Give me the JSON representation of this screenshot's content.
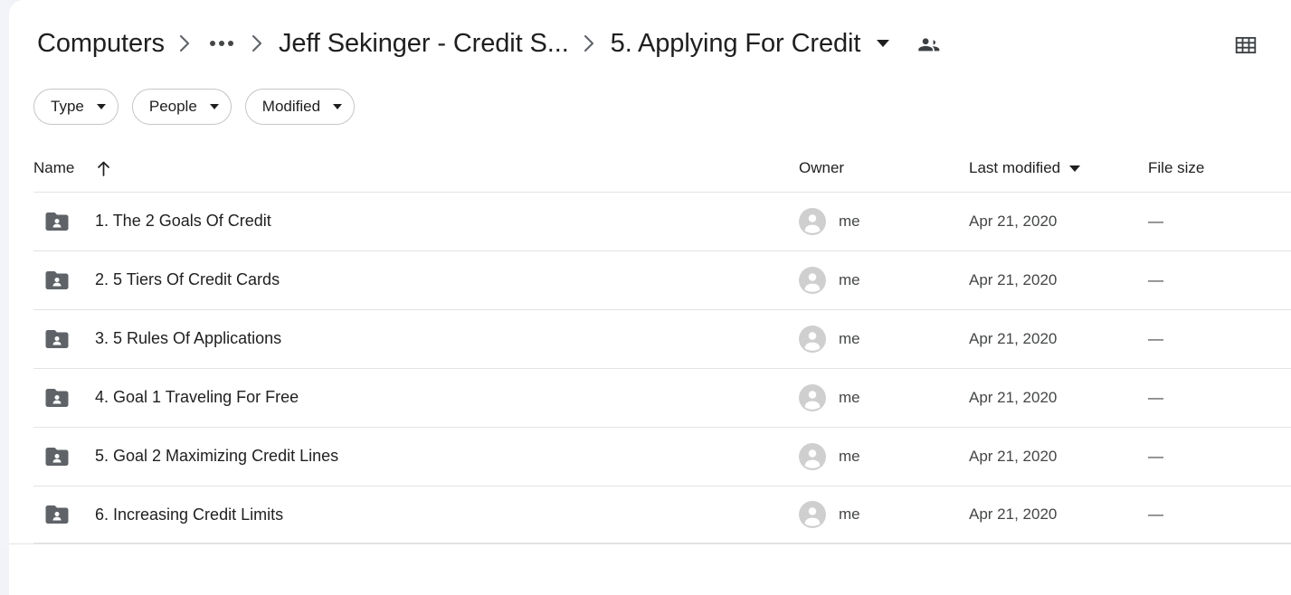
{
  "breadcrumb": {
    "root_label": "Computers",
    "overflow_label": "...",
    "parent_label": "Jeff Sekinger - Credit S...",
    "current_label": "5. Applying For Credit",
    "separator": "›"
  },
  "header": {
    "people_icon": "people-icon",
    "grid_view_icon": "grid-view-icon",
    "title_caret_icon": "chevron-down-icon"
  },
  "filters": [
    {
      "label": "Type",
      "caret": "chevron-down-icon"
    },
    {
      "label": "People",
      "caret": "chevron-down-icon"
    },
    {
      "label": "Modified",
      "caret": "chevron-down-icon"
    }
  ],
  "columns": {
    "name": "Name",
    "name_sort_icon": "arrow-up-icon",
    "owner": "Owner",
    "last_modified": "Last modified",
    "last_modified_caret": "chevron-down-icon",
    "file_size": "File size"
  },
  "colors": {
    "folder_icon": "#5f6368",
    "avatar": "#cfcfcf",
    "text_primary": "#1f1f1f",
    "text_secondary": "#444746",
    "divider": "#e3e3e3",
    "chip_border": "#c4c7c5",
    "left_gutter": "#f3f4fa"
  },
  "rows": [
    {
      "name": "1. The 2 Goals Of Credit",
      "icon": "shared-folder-icon",
      "owner": "me",
      "modified": "Apr 21, 2020",
      "size": "—"
    },
    {
      "name": "2. 5 Tiers Of Credit Cards",
      "icon": "shared-folder-icon",
      "owner": "me",
      "modified": "Apr 21, 2020",
      "size": "—"
    },
    {
      "name": "3. 5 Rules Of Applications",
      "icon": "shared-folder-icon",
      "owner": "me",
      "modified": "Apr 21, 2020",
      "size": "—"
    },
    {
      "name": "4. Goal 1 Traveling For Free",
      "icon": "shared-folder-icon",
      "owner": "me",
      "modified": "Apr 21, 2020",
      "size": "—"
    },
    {
      "name": "5. Goal 2 Maximizing Credit Lines",
      "icon": "shared-folder-icon",
      "owner": "me",
      "modified": "Apr 21, 2020",
      "size": "—"
    },
    {
      "name": "6. Increasing Credit Limits",
      "icon": "shared-folder-icon",
      "owner": "me",
      "modified": "Apr 21, 2020",
      "size": "—"
    }
  ]
}
